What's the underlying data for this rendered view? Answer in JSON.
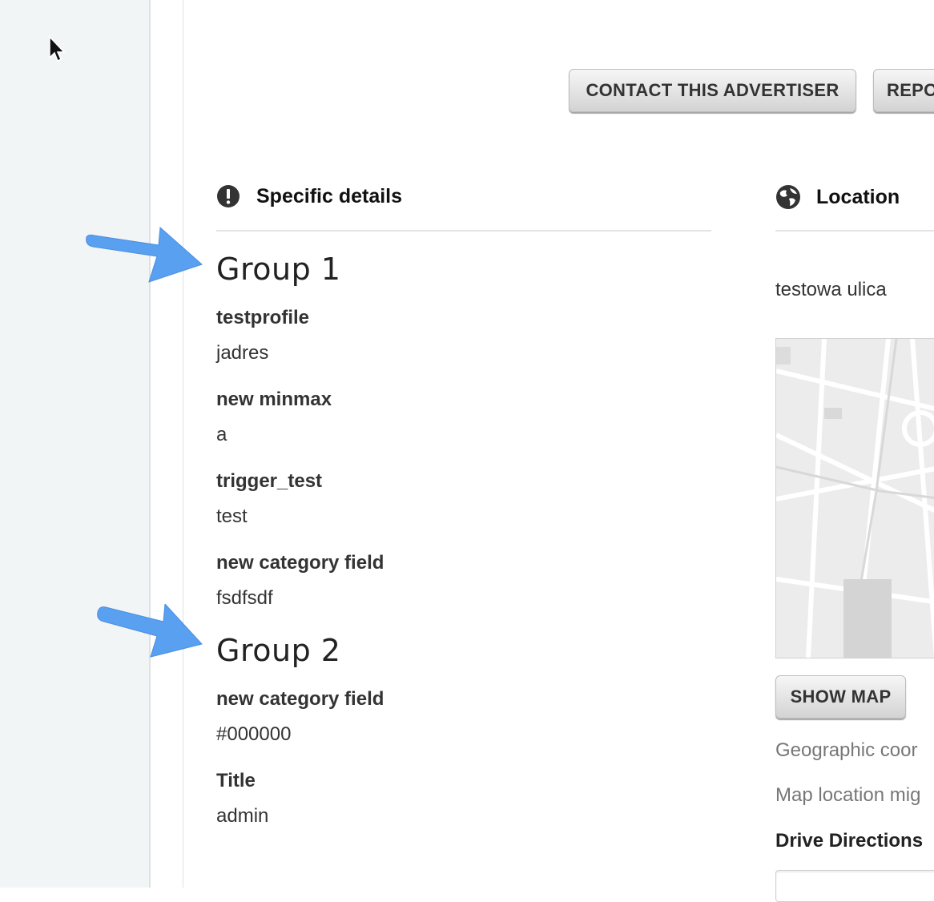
{
  "header": {
    "contact_button": "CONTACT THIS ADVERTISER",
    "report_button": "REPO"
  },
  "details": {
    "heading": "Specific details",
    "groups": [
      {
        "title": "Group 1",
        "fields": [
          {
            "label": "testprofile",
            "value": "jadres"
          },
          {
            "label": "new minmax",
            "value": "a"
          },
          {
            "label": "trigger_test",
            "value": "test"
          },
          {
            "label": "new category field",
            "value": "fsdfsdf"
          }
        ]
      },
      {
        "title": "Group 2",
        "fields": [
          {
            "label": "new category field",
            "value": "#000000"
          },
          {
            "label": "Title",
            "value": "admin"
          }
        ]
      }
    ]
  },
  "location": {
    "heading": "Location",
    "address": "testowa ulica",
    "show_map_button": "SHOW MAP",
    "geo_text": "Geographic coor",
    "map_note": "Map location mig",
    "drive_heading": "Drive Directions",
    "drive_placeholder": ""
  },
  "colors": {
    "arrow": "#5aa0f0",
    "sidebar_bg": "#f2f5f6"
  }
}
